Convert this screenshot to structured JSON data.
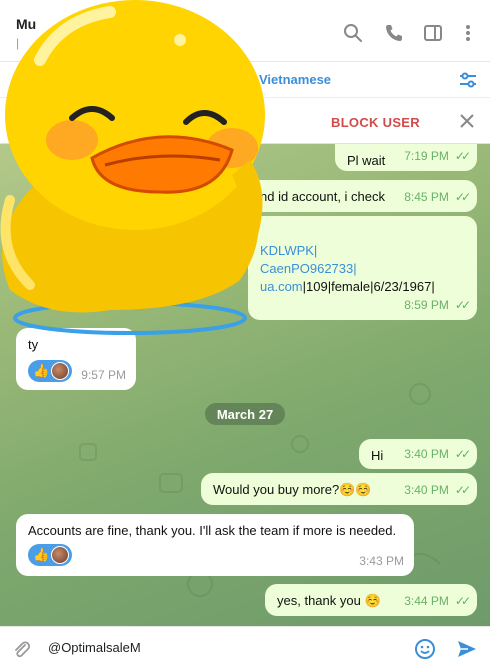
{
  "header": {
    "title": "Mu",
    "subtitle": "|",
    "icons": [
      "search-icon",
      "phone-icon",
      "sidebar-icon",
      "more-icon"
    ]
  },
  "translate_bar": {
    "label": "Vietnamese",
    "icon": "sliders-icon"
  },
  "block_bar": {
    "label": "BLOCK USER",
    "close_icon": "close-icon"
  },
  "messages": [
    {
      "type": "out",
      "text": "Pl wait",
      "time": "7:19 PM"
    },
    {
      "type": "out",
      "text": "nd id account, i check",
      "time": "8:45 PM"
    },
    {
      "type": "out",
      "text_lines": [
        "KDLWPK|",
        "CaenPO962733|",
        "ua.com|109|female|6/23/1967|"
      ],
      "time": "8:59 PM"
    },
    {
      "type": "in",
      "text": "ty",
      "time": "9:57 PM",
      "reaction": "👍"
    },
    {
      "type": "date",
      "text": "March 27"
    },
    {
      "type": "out",
      "text": "Hi",
      "time": "3:40 PM"
    },
    {
      "type": "out",
      "text": "Would you buy more?",
      "emoji": "☺️☺️",
      "time": "3:40 PM"
    },
    {
      "type": "in",
      "text": "Accounts are fine, thank you. I'll ask the team if more is needed.",
      "time": "3:43 PM",
      "reaction": "👍"
    },
    {
      "type": "out",
      "text": "yes, thank you",
      "emoji": "☺️",
      "time": "3:44 PM"
    }
  ],
  "composer": {
    "value": "@OptimalsaleM",
    "icons": [
      "attach-icon",
      "emoji-icon",
      "send-icon"
    ]
  },
  "colors": {
    "accent": "#3a8fd8",
    "danger": "#d24b4b",
    "outgoing": "#eefed8",
    "incoming": "#ffffff",
    "chat_bg": "#8fb276"
  }
}
